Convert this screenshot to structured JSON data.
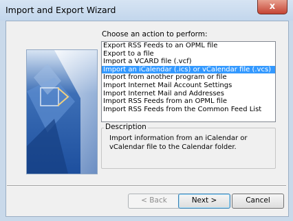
{
  "window": {
    "title": "Import and Export Wizard",
    "close_glyph": "x"
  },
  "wizard": {
    "prompt": "Choose an action to perform:",
    "actions": [
      "Export RSS Feeds to an OPML file",
      "Export to a file",
      "Import a VCARD file (.vcf)",
      "Import an iCalendar (.ics) or vCalendar file (.vcs)",
      "Import from another program or file",
      "Import Internet Mail Account Settings",
      "Import Internet Mail and Addresses",
      "Import RSS Feeds from an OPML file",
      "Import RSS Feeds from the Common Feed List"
    ],
    "selected_index": 3,
    "description_label": "Description",
    "description_text": "Import information from an iCalendar or vCalendar file to the Calendar folder."
  },
  "buttons": {
    "back": "< Back",
    "next": "Next >",
    "cancel": "Cancel"
  },
  "colors": {
    "selection": "#3399ff",
    "titlebar": "#c9d9ea",
    "close": "#c54434"
  }
}
